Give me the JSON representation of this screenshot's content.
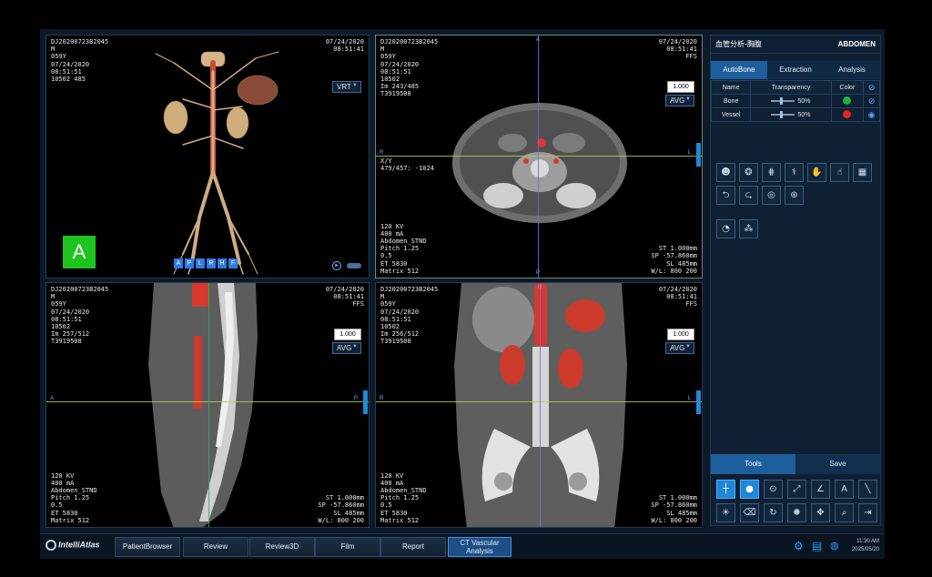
{
  "viewports": {
    "vr": {
      "tl": "DJ20200723B2045\nM\n059Y\n07/24/2020\n08:51:51\n10502 485",
      "tr": "07/24/2020\n08:51:41",
      "mode": "VRT",
      "orient_label": "A",
      "orient_buttons": [
        "A",
        "P",
        "L",
        "R",
        "H",
        "F"
      ]
    },
    "axial": {
      "tl": "DJ20200723B2045\nM\n059Y\n07/24/2020\n08:51:51\n10502\nIm 243/485\nT3919508",
      "tr": "07/24/2020\n08:51:41\nFFS",
      "zoom": "1.000",
      "mode": "AVG",
      "coord": "X/Y\n479/457: -1024",
      "bl": "120 KV\n400 mA\nAbdomen_STND\nPitch 1.25\n0.5\nET 5830\nMatrix 512",
      "br": "ST 1.000mm\nSP -57.860mm\nSL 485mm\nW/L: 800 200",
      "labels": {
        "top": "A",
        "bottom": "P",
        "left": "R",
        "right": "L"
      }
    },
    "sagittal": {
      "tl": "DJ20200723B2045\nM\n059Y\n07/24/2020\n08:51:51\n10502\nIm 257/512\nT3919508",
      "tr": "07/24/2020\n08:51:41\nFFS",
      "zoom": "1.000",
      "mode": "AVG",
      "bl": "120 KV\n400 mA\nAbdomen_STND\nPitch 1.25\n0.5\nET 5830\nMatrix 512",
      "br": "ST 1.000mm\nSP -57.860mm\nSL 485mm\nW/L: 800 200",
      "labels": {
        "left": "A",
        "right": "P"
      }
    },
    "coronal": {
      "tl": "DJ20200723B2045\nM\n059Y\n07/24/2020\n08:51:51\n10502\nIm 256/512\nT3919508",
      "tr": "07/24/2020\n08:51:41\nFFS",
      "zoom": "1.000",
      "mode": "AVG",
      "bl": "120 KV\n400 mA\nAbdomen_STND\nPitch 1.25\n0.5\nET 5830\nMatrix 512",
      "br": "ST 1.000mm\nSP -57.860mm\nSL 485mm\nW/L: 800 200",
      "labels": {
        "top": "H",
        "left": "R",
        "right": "L"
      }
    }
  },
  "panel": {
    "title": "血管分析-胸腹",
    "protocol": "ABDOMEN",
    "tabs": [
      "AutoBone",
      "Extraction",
      "Analysis"
    ],
    "table": {
      "headers": [
        "Name",
        "Transparency",
        "Color"
      ],
      "rows": [
        {
          "name": "Bone",
          "transparency": "50%",
          "color": "#1db33b"
        },
        {
          "name": "Vessel",
          "transparency": "50%",
          "color": "#e8231e"
        }
      ]
    },
    "bottom_tabs": [
      "Tools",
      "Save"
    ]
  },
  "bottombar": {
    "logo": "IntelliAtlas",
    "buttons": [
      "PatientBrowser",
      "Review",
      "Review3D",
      "Film",
      "Report"
    ],
    "active_line1": "CT Vascular",
    "active_line2": "Analysis",
    "time": "11:30 AM",
    "date": "2025/05/20"
  }
}
